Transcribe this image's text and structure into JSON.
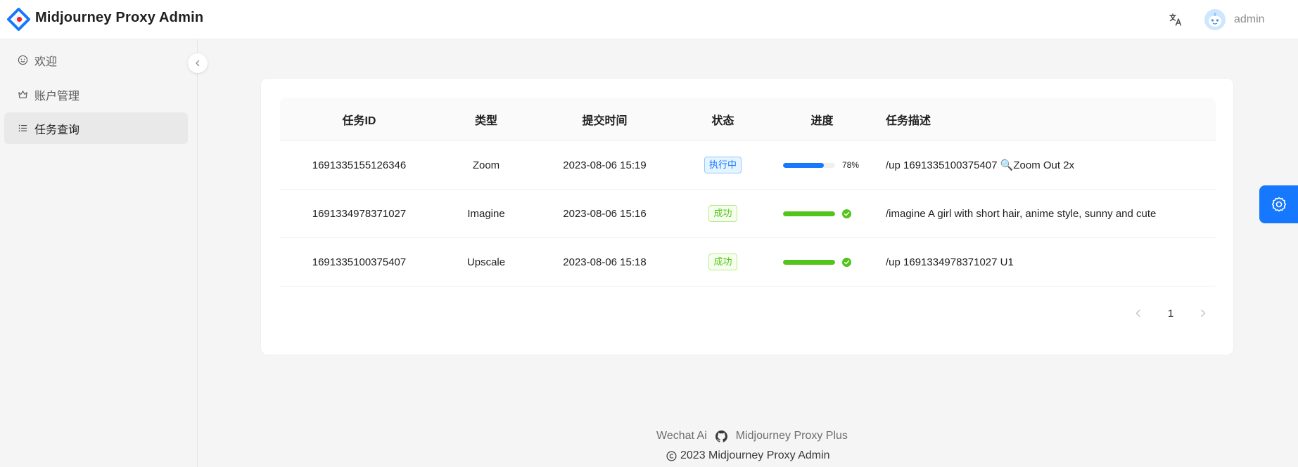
{
  "header": {
    "title": "Midjourney Proxy Admin",
    "username": "admin",
    "lang_icon": "translate-icon",
    "logo_icon": "diamond-logo-icon"
  },
  "sidebar": {
    "items": [
      {
        "label": "欢迎",
        "icon": "smile-icon",
        "active": false
      },
      {
        "label": "账户管理",
        "icon": "crown-icon",
        "active": false
      },
      {
        "label": "任务查询",
        "icon": "list-icon",
        "active": true
      }
    ]
  },
  "table": {
    "columns": [
      "任务ID",
      "类型",
      "提交时间",
      "状态",
      "进度",
      "任务描述"
    ],
    "rows": [
      {
        "id": "1691335155126346",
        "type": "Zoom",
        "time": "2023-08-06 15:19",
        "status": "执行中",
        "status_color": "blue",
        "progress": 78,
        "progress_label": "78%",
        "desc": "/up 1691335100375407 🔍Zoom Out 2x"
      },
      {
        "id": "1691334978371027",
        "type": "Imagine",
        "time": "2023-08-06 15:16",
        "status": "成功",
        "status_color": "green",
        "progress": 100,
        "progress_label": "",
        "desc": "/imagine A girl with short hair, anime style, sunny and cute"
      },
      {
        "id": "1691335100375407",
        "type": "Upscale",
        "time": "2023-08-06 15:18",
        "status": "成功",
        "status_color": "green",
        "progress": 100,
        "progress_label": "",
        "desc": "/up 1691334978371027 U1"
      }
    ]
  },
  "pagination": {
    "current": "1"
  },
  "footer": {
    "link1": "Wechat Ai",
    "link2": "Midjourney Proxy Plus",
    "copyright": "2023 Midjourney Proxy Admin"
  },
  "colors": {
    "primary": "#1677ff",
    "success": "#52c41a"
  }
}
